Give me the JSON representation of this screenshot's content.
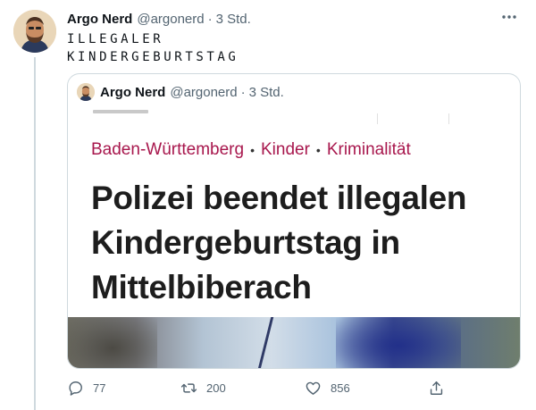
{
  "tweet": {
    "author_name": "Argo Nerd",
    "author_handle": "@argonerd",
    "separator": "·",
    "time": "3 Std.",
    "text_line1": "ILLEGALER",
    "text_line2": "KINDERGEBURTSTAG"
  },
  "quoted_tweet": {
    "author_name": "Argo Nerd",
    "author_handle": "@argonerd",
    "separator": "·",
    "time": "3 Std.",
    "article": {
      "tag1": "Baden-Württemberg",
      "tag2": "Kinder",
      "tag3": "Kriminalität",
      "tag_separator": "•",
      "headline": "Polizei beendet illegalen Kindergeburtstag in Mittelbiberach",
      "tag_color": "#a8174d"
    }
  },
  "actions": {
    "reply_count": "77",
    "retweet_count": "200",
    "like_count": "856"
  },
  "colors": {
    "secondary_text": "#536471",
    "border": "#cfd9de"
  },
  "icons": [
    "more-icon",
    "reply-icon",
    "retweet-icon",
    "like-icon",
    "share-icon"
  ]
}
